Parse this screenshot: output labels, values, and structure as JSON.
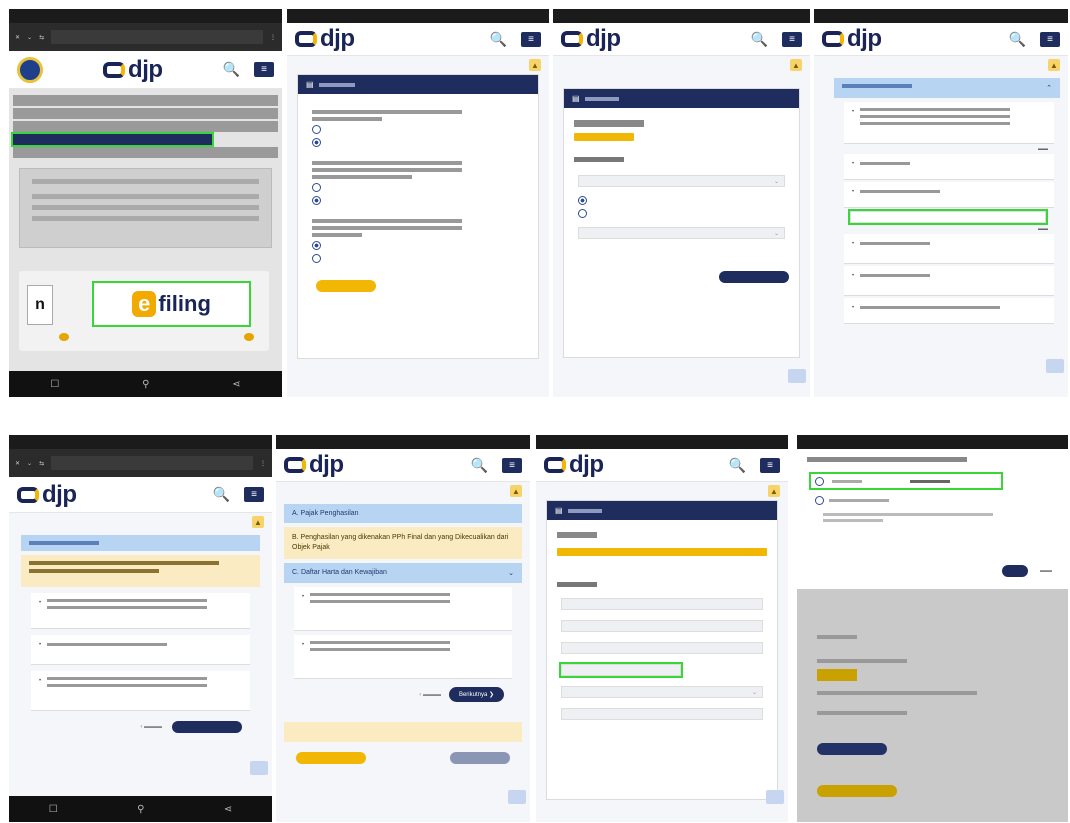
{
  "common": {
    "logo_text": "djp",
    "search_glyph": "🔍",
    "menu_glyph": "≡",
    "bell_glyph": "▲"
  },
  "efiling": {
    "logo_letter": "e",
    "logo_word": "filing",
    "partial_logo": "n"
  },
  "p6": {
    "acc": [
      "A. Pajak Penghasilan",
      "B. Penghasilan yang dikenakan PPh Final dan yang Dikecualikan dari Objek Pajak",
      "C. Daftar Harta dan Kewajiban"
    ],
    "next_btn": "Berikutnya ❯"
  }
}
